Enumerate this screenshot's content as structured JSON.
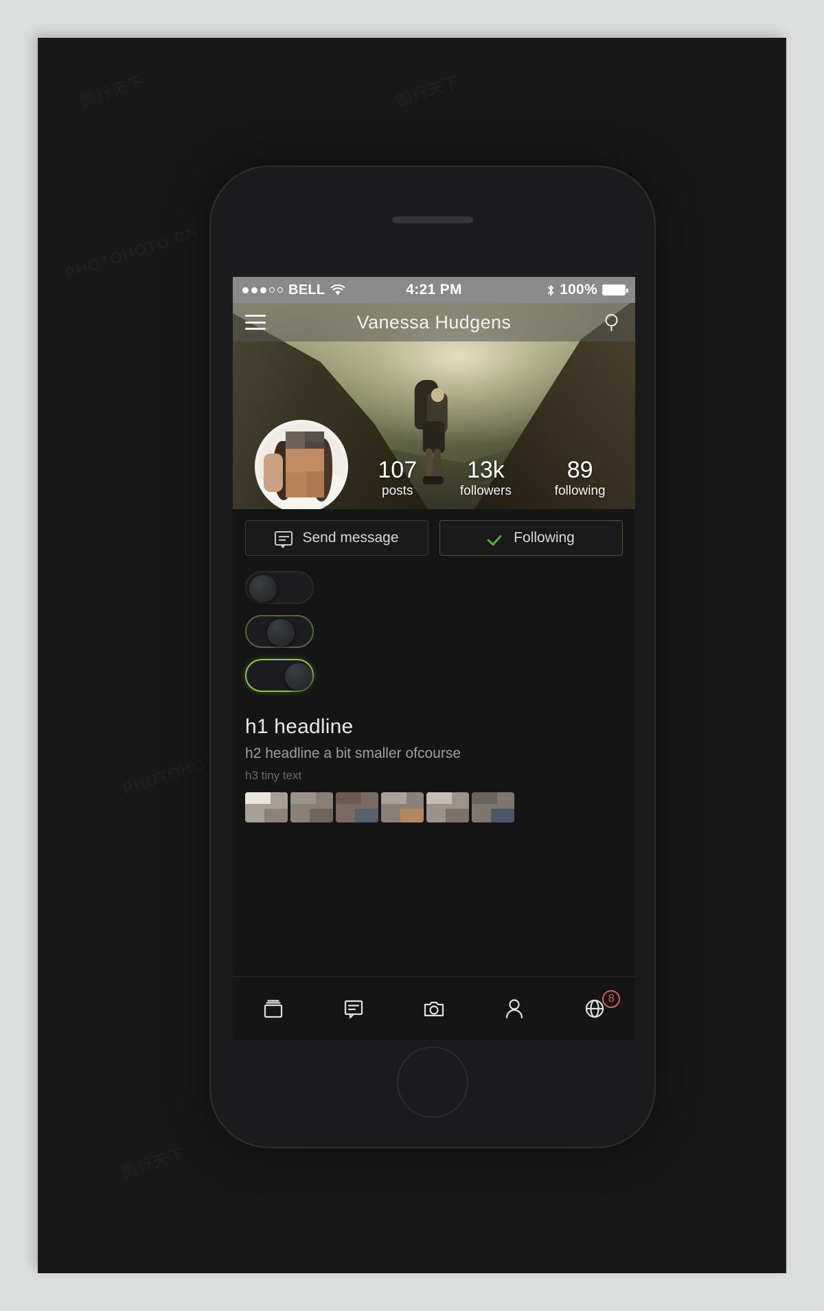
{
  "status_bar": {
    "signal_dots_filled": 3,
    "signal_dots_total": 5,
    "carrier": "BELL",
    "wifi_icon": "wifi-icon",
    "time": "4:21 PM",
    "bluetooth_icon": "bluetooth-icon",
    "battery_percent": "100%",
    "battery_icon": "battery-full-icon"
  },
  "nav_bar": {
    "menu_icon": "hamburger-menu-icon",
    "title": "Vanessa Hudgens",
    "search_icon": "search-icon"
  },
  "hero": {
    "avatar_alt": "profile-avatar",
    "stats": [
      {
        "value": "107",
        "label": "posts"
      },
      {
        "value": "13k",
        "label": "followers"
      },
      {
        "value": "89",
        "label": "following"
      }
    ]
  },
  "actions": [
    {
      "icon": "message-bubble-icon",
      "label": "Send message",
      "state": "default"
    },
    {
      "icon": "check-icon",
      "label": "Following",
      "state": "active"
    }
  ],
  "toggles": [
    {
      "name": "toggle-off",
      "state": "off"
    },
    {
      "name": "toggle-mid",
      "state": "mid"
    },
    {
      "name": "toggle-on",
      "state": "on"
    }
  ],
  "headlines": {
    "h1": "h1 headline",
    "h2": "h2 headline a bit smaller ofcourse",
    "h3": "h3 tiny text"
  },
  "thumbnails": [
    {
      "name": "thumbnail-1"
    },
    {
      "name": "thumbnail-2"
    },
    {
      "name": "thumbnail-3"
    },
    {
      "name": "thumbnail-4"
    },
    {
      "name": "thumbnail-5"
    },
    {
      "name": "thumbnail-6"
    }
  ],
  "tabbar": [
    {
      "icon": "cards-stack-icon",
      "badge": null
    },
    {
      "icon": "chat-bubble-icon",
      "badge": null
    },
    {
      "icon": "camera-icon",
      "badge": null
    },
    {
      "icon": "person-icon",
      "badge": null
    },
    {
      "icon": "globe-icon",
      "badge": "8"
    }
  ],
  "colors": {
    "page_background": "#dcdddd",
    "artboard": "#191919",
    "phone_body": "#1b1b1d",
    "screen": "#151515",
    "status_bar": "#8a8a8a",
    "accent_green": "#8cc552",
    "check_green": "#5fae3c",
    "badge_red": "#e05a5a",
    "text_primary": "#e9e9e9",
    "text_secondary": "#9e9e9e",
    "text_tertiary": "#6a6a6a"
  },
  "watermarks": {
    "cn": "PHOTOHOTO.CN",
    "brand": "图行天下"
  }
}
